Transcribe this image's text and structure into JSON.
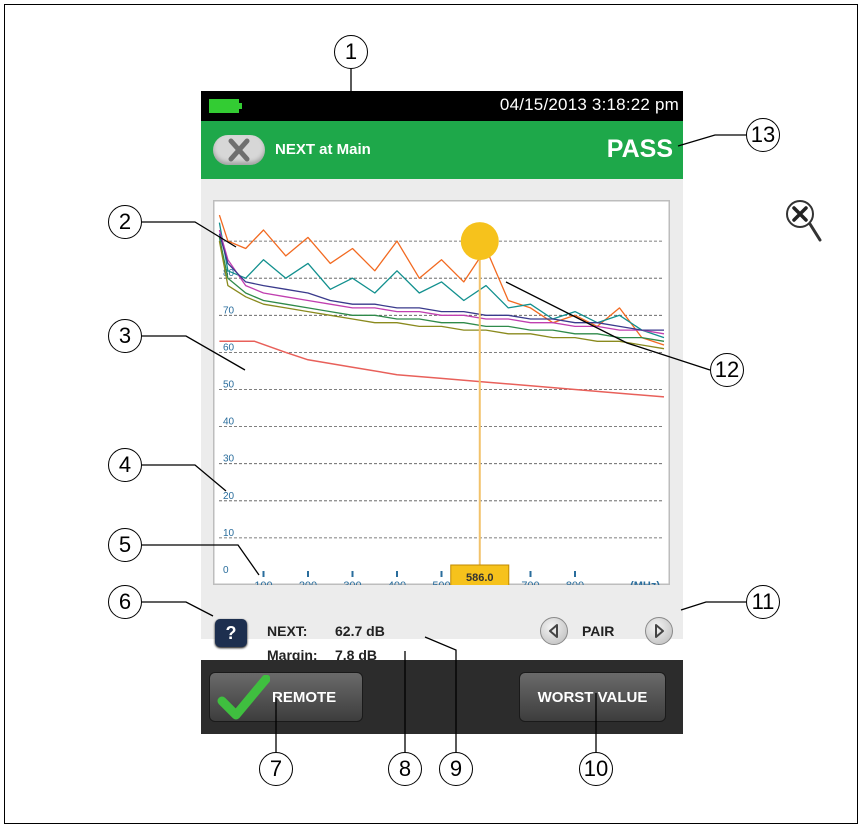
{
  "status_bar": {
    "datetime": "04/15/2013 3:18:22 pm",
    "battery_color": "#33cc33"
  },
  "header": {
    "title": "NEXT at Main",
    "result": "PASS",
    "color": "#1ea84a"
  },
  "chart_data": {
    "type": "line",
    "xlabel": "(MHz)",
    "x_ticks": [
      "100",
      "200",
      "300",
      "400",
      "500",
      "700",
      "800"
    ],
    "y_ticks": [
      "0",
      "10",
      "20",
      "30",
      "40",
      "50",
      "60",
      "70",
      "80"
    ],
    "xlim": [
      0,
      1000
    ],
    "ylim": [
      0,
      100
    ],
    "grid": true,
    "cursor": {
      "x": 586.0,
      "label": "586.0"
    },
    "worst_point": {
      "x": 586.0,
      "y": 90
    },
    "series": [
      {
        "color": "#f26a21",
        "points": [
          [
            1,
            97
          ],
          [
            20,
            90
          ],
          [
            60,
            88
          ],
          [
            100,
            93
          ],
          [
            150,
            86
          ],
          [
            200,
            91
          ],
          [
            250,
            84
          ],
          [
            300,
            88
          ],
          [
            350,
            82
          ],
          [
            400,
            90
          ],
          [
            450,
            80
          ],
          [
            500,
            85
          ],
          [
            550,
            79
          ],
          [
            600,
            88
          ],
          [
            650,
            74
          ],
          [
            700,
            72
          ],
          [
            750,
            68
          ],
          [
            800,
            70
          ],
          [
            850,
            67
          ],
          [
            900,
            72
          ],
          [
            950,
            64
          ],
          [
            1000,
            62
          ]
        ]
      },
      {
        "color": "#12908e",
        "points": [
          [
            1,
            95
          ],
          [
            20,
            82
          ],
          [
            60,
            80
          ],
          [
            100,
            85
          ],
          [
            150,
            80
          ],
          [
            200,
            84
          ],
          [
            250,
            77
          ],
          [
            300,
            80
          ],
          [
            350,
            76
          ],
          [
            400,
            82
          ],
          [
            450,
            76
          ],
          [
            500,
            79
          ],
          [
            550,
            74
          ],
          [
            600,
            78
          ],
          [
            650,
            72
          ],
          [
            700,
            73
          ],
          [
            750,
            69
          ],
          [
            800,
            71
          ],
          [
            850,
            68
          ],
          [
            900,
            70
          ],
          [
            950,
            66
          ],
          [
            1000,
            64
          ]
        ]
      },
      {
        "color": "#c03fb0",
        "points": [
          [
            1,
            93
          ],
          [
            20,
            85
          ],
          [
            60,
            78
          ],
          [
            100,
            76
          ],
          [
            150,
            75
          ],
          [
            200,
            74
          ],
          [
            250,
            73
          ],
          [
            300,
            72
          ],
          [
            350,
            72
          ],
          [
            400,
            71
          ],
          [
            450,
            71
          ],
          [
            500,
            70
          ],
          [
            550,
            70
          ],
          [
            600,
            69
          ],
          [
            650,
            69
          ],
          [
            700,
            68
          ],
          [
            750,
            68
          ],
          [
            800,
            67
          ],
          [
            850,
            67
          ],
          [
            900,
            66
          ],
          [
            950,
            66
          ],
          [
            1000,
            65
          ]
        ]
      },
      {
        "color": "#3a3a8c",
        "points": [
          [
            1,
            92
          ],
          [
            20,
            84
          ],
          [
            60,
            79
          ],
          [
            100,
            78
          ],
          [
            150,
            77
          ],
          [
            200,
            76
          ],
          [
            250,
            74
          ],
          [
            300,
            73
          ],
          [
            350,
            73
          ],
          [
            400,
            72
          ],
          [
            450,
            72
          ],
          [
            500,
            71
          ],
          [
            550,
            71
          ],
          [
            600,
            70
          ],
          [
            650,
            70
          ],
          [
            700,
            69
          ],
          [
            750,
            69
          ],
          [
            800,
            68
          ],
          [
            850,
            68
          ],
          [
            900,
            67
          ],
          [
            950,
            66
          ],
          [
            1000,
            66
          ]
        ]
      },
      {
        "color": "#2f8a4a",
        "points": [
          [
            1,
            91
          ],
          [
            20,
            80
          ],
          [
            60,
            76
          ],
          [
            100,
            74
          ],
          [
            150,
            73
          ],
          [
            200,
            72
          ],
          [
            250,
            71
          ],
          [
            300,
            70
          ],
          [
            350,
            70
          ],
          [
            400,
            69
          ],
          [
            450,
            69
          ],
          [
            500,
            68
          ],
          [
            550,
            68
          ],
          [
            600,
            67
          ],
          [
            650,
            67
          ],
          [
            700,
            66
          ],
          [
            750,
            66
          ],
          [
            800,
            65
          ],
          [
            850,
            65
          ],
          [
            900,
            64
          ],
          [
            950,
            64
          ],
          [
            1000,
            63
          ]
        ]
      },
      {
        "color": "#8a8a1e",
        "points": [
          [
            1,
            90
          ],
          [
            20,
            78
          ],
          [
            60,
            75
          ],
          [
            100,
            73
          ],
          [
            150,
            72
          ],
          [
            200,
            71
          ],
          [
            250,
            70
          ],
          [
            300,
            69
          ],
          [
            350,
            68
          ],
          [
            400,
            68
          ],
          [
            450,
            67
          ],
          [
            500,
            67
          ],
          [
            550,
            66
          ],
          [
            600,
            66
          ],
          [
            650,
            65
          ],
          [
            700,
            65
          ],
          [
            750,
            64
          ],
          [
            800,
            64
          ],
          [
            850,
            63
          ],
          [
            900,
            63
          ],
          [
            950,
            62
          ],
          [
            1000,
            61
          ]
        ]
      },
      {
        "color": "#e8605a",
        "points": [
          [
            1,
            63
          ],
          [
            80,
            63
          ],
          [
            150,
            60
          ],
          [
            200,
            58
          ],
          [
            300,
            56
          ],
          [
            400,
            54
          ],
          [
            500,
            53
          ],
          [
            600,
            52
          ],
          [
            700,
            51
          ],
          [
            800,
            50
          ],
          [
            900,
            49
          ],
          [
            1000,
            48
          ]
        ]
      }
    ]
  },
  "readout": {
    "next_label": "NEXT:",
    "next_value": "62.7 dB",
    "margin_label": "Margin:",
    "margin_value": "7.8 dB"
  },
  "pair": {
    "label": "PAIR"
  },
  "buttons": {
    "remote_label": "REMOTE",
    "worst_label": "WORST VALUE"
  },
  "callouts": [
    "1",
    "2",
    "3",
    "4",
    "5",
    "6",
    "7",
    "8",
    "9",
    "10",
    "11",
    "12",
    "13"
  ],
  "help_label": "?"
}
